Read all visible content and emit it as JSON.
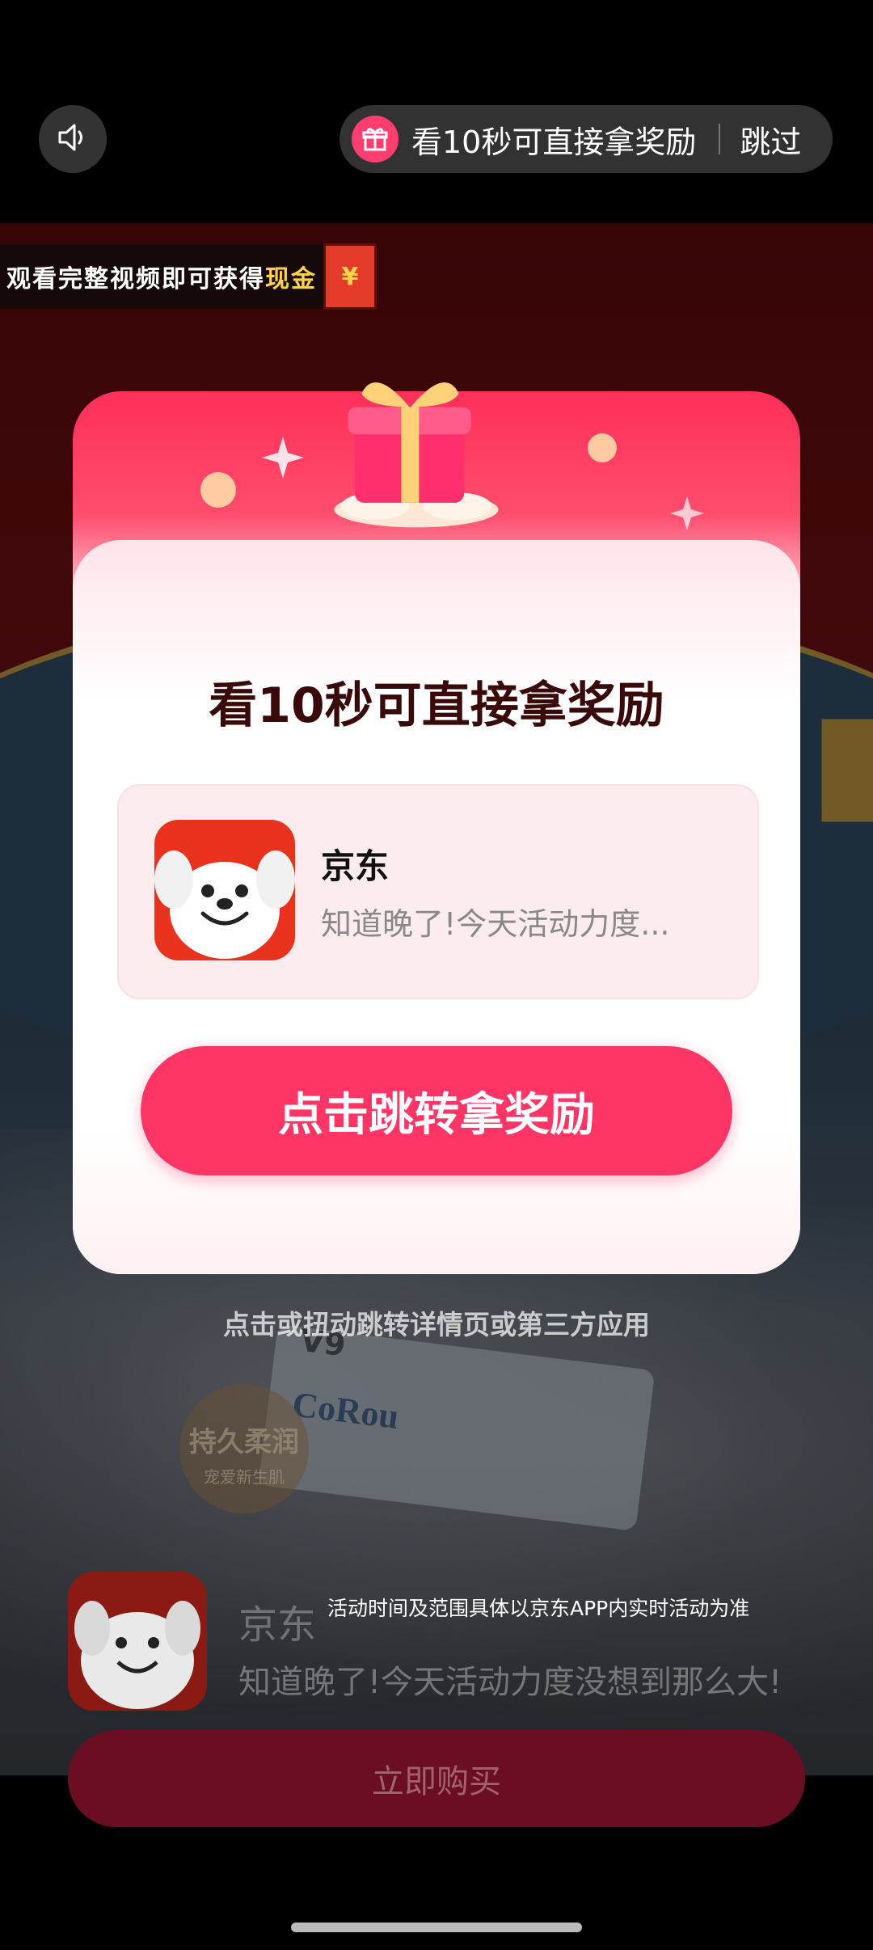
{
  "top_bar": {
    "sound_icon": "speaker-icon",
    "reward_pill_text": "看10秒可直接拿奖励",
    "skip_label": "跳过",
    "gift_icon": "gift-icon"
  },
  "cash_banner": {
    "text_prefix": "观看完整视频即可获得",
    "text_highlight": "现金",
    "envelope_symbol": "¥"
  },
  "modal": {
    "title": "看10秒可直接拿奖励",
    "app_name": "京东",
    "app_desc": "知道晚了!今天活动力度...",
    "cta_label": "点击跳转拿奖励"
  },
  "video": {
    "product_brand": "CoRou",
    "product_model": "V9",
    "badge_line1": "持久柔润",
    "badge_line2": "宠爱新生肌"
  },
  "hint_text": "点击或扭动跳转详情页或第三方应用",
  "bottom": {
    "app_name": "京东",
    "app_desc": "知道晚了!今天活动力度没想到那么大!",
    "note": "活动时间及范围具体以京东APP内实时活动为准",
    "buy_label": "立即购买"
  },
  "colors": {
    "accent": "#ff3566",
    "modal_title": "#3a0a0a",
    "buy_button": "#6c0e22"
  }
}
